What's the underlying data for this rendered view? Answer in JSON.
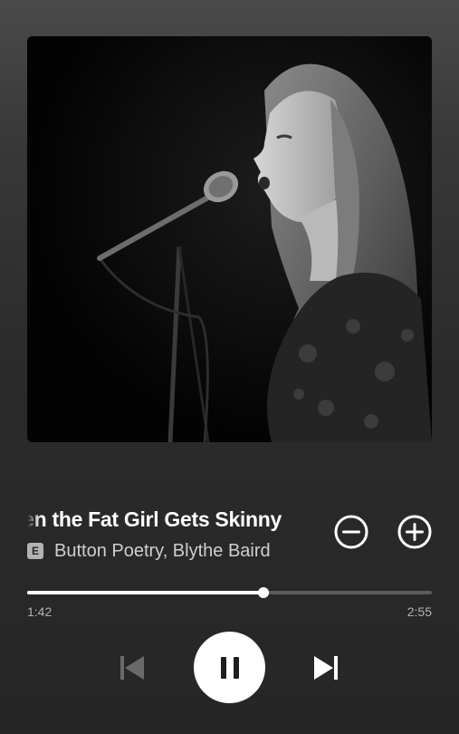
{
  "track": {
    "title": "When the Fat Girl Gets Skinny",
    "explicit_badge": "E",
    "artists": "Button Poetry, Blythe Baird"
  },
  "artwork": {
    "description_icon": "album-artwork"
  },
  "playback": {
    "elapsed": "1:42",
    "duration": "2:55",
    "progress_fraction": 0.583,
    "state": "playing"
  },
  "controls": {
    "decrease_icon": "minus-circle-icon",
    "increase_icon": "plus-circle-icon",
    "previous_icon": "skip-previous-icon",
    "play_pause_icon": "pause-icon",
    "next_icon": "skip-next-icon"
  },
  "colors": {
    "accent": "#ffffff",
    "track_bg": "#5b5b5b",
    "secondary_text": "#b3b3b3",
    "previous_disabled": "#6a6a6a"
  }
}
